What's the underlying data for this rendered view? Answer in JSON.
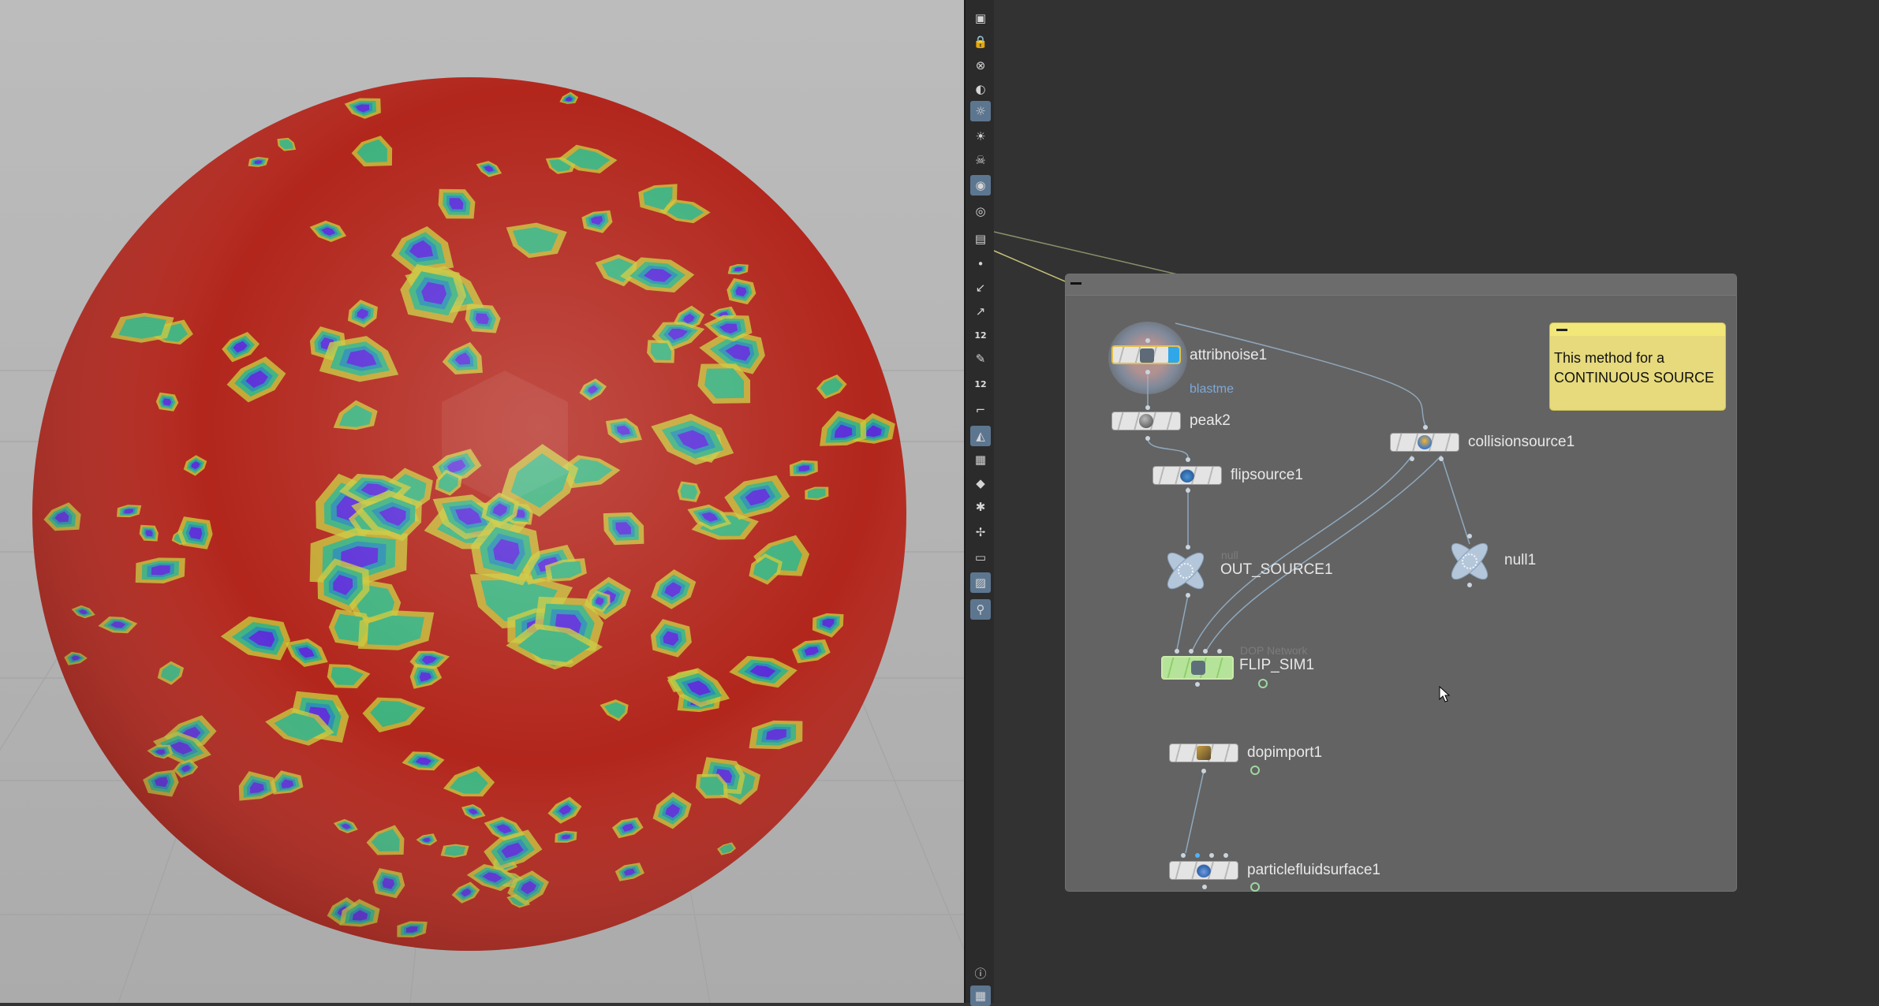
{
  "viewport": {
    "sphere_colors": {
      "base": "#b2261c",
      "yellow": "#c9c83a",
      "green": "#3fb27e",
      "teal": "#2a90b0",
      "blue": "#5b2fd8"
    }
  },
  "toolbar": {
    "items": [
      {
        "icon": "geometry-icon"
      },
      {
        "icon": "lock-icon"
      },
      {
        "icon": "close-circle-icon"
      },
      {
        "icon": "sphere-display-icon"
      },
      {
        "icon": "light-bulb-icon"
      },
      {
        "icon": "light-bulb-outline-icon"
      },
      {
        "icon": "skull-icon"
      },
      {
        "icon": "camera-icon"
      },
      {
        "icon": "eye-icon"
      },
      {
        "icon": "camera-small-icon"
      },
      {
        "icon": "point-icon"
      },
      {
        "icon": "normal-icon"
      },
      {
        "icon": "vector-icon"
      },
      {
        "icon": "point-number-icon",
        "text": "12"
      },
      {
        "icon": "brush-icon"
      },
      {
        "icon": "primitive-number-icon",
        "text": "12"
      },
      {
        "icon": "ruler-icon"
      },
      {
        "icon": "shading-icon"
      },
      {
        "icon": "checker-icon"
      },
      {
        "icon": "diamond-icon"
      },
      {
        "icon": "gremlin-icon"
      },
      {
        "icon": "snap-icon"
      },
      {
        "icon": "box-icon"
      },
      {
        "icon": "background-image-icon"
      },
      {
        "icon": "pin-icon"
      },
      {
        "icon": "info-icon"
      },
      {
        "icon": "grid-icon"
      }
    ]
  },
  "network": {
    "nodes": {
      "attribnoise": {
        "label": "attribnoise1",
        "sublabel": "blastme"
      },
      "peak": {
        "label": "peak2"
      },
      "flipsource": {
        "label": "flipsource1"
      },
      "out_source": {
        "label": "OUT_SOURCE1",
        "ghost": "null"
      },
      "collisionsource": {
        "label": "collisionsource1"
      },
      "null1": {
        "label": "null1"
      },
      "flip_sim": {
        "label": "FLIP_SIM1",
        "ghost": "DOP Network"
      },
      "dopimport": {
        "label": "dopimport1"
      },
      "particlefluidsurface": {
        "label": "particlefluidsurface1"
      }
    },
    "sticky_note": {
      "text": "This method for a\nCONTINUOUS SOURCE"
    }
  }
}
